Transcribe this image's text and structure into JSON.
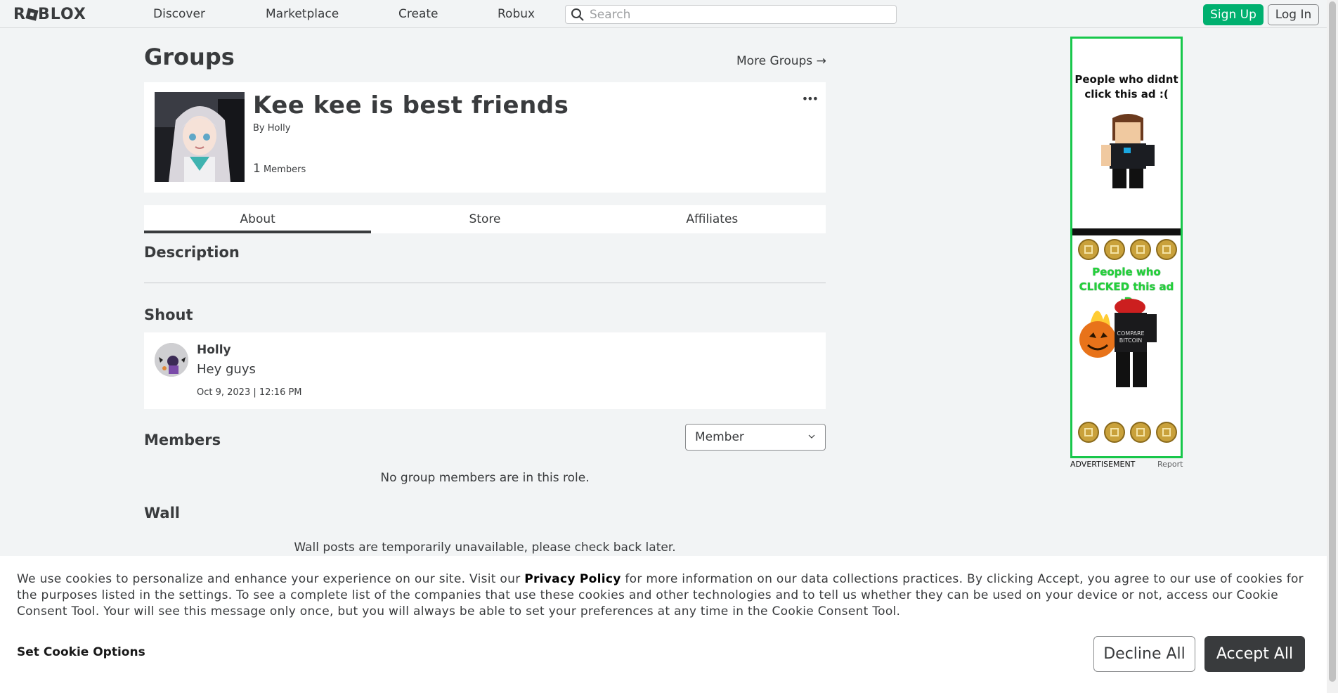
{
  "topbar": {
    "logo": "ROBLOX",
    "nav": [
      "Discover",
      "Marketplace",
      "Create",
      "Robux"
    ],
    "search_placeholder": "Search",
    "signup_label": "Sign Up",
    "login_label": "Log In"
  },
  "page": {
    "title": "Groups",
    "more_groups": "More Groups →"
  },
  "group": {
    "name": "Kee kee is best friends",
    "by_prefix": "By",
    "owner": "Holly",
    "member_count": "1",
    "members_label": "Members",
    "more_menu": "•••"
  },
  "tabs": [
    {
      "label": "About",
      "active": true
    },
    {
      "label": "Store",
      "active": false
    },
    {
      "label": "Affiliates",
      "active": false
    }
  ],
  "sections": {
    "description": "Description",
    "shout": "Shout",
    "members": "Members",
    "wall": "Wall"
  },
  "shout": {
    "user": "Holly",
    "message": "Hey guys",
    "date": "Oct 9, 2023 | 12:16 PM"
  },
  "members": {
    "role_selected": "Member",
    "empty_note": "No group members are in this role."
  },
  "wall": {
    "note": "Wall posts are temporarily unavailable, please check back later."
  },
  "ad": {
    "line1": "People who didnt click this ad :(",
    "line2": "People who CLICKED this ad :D",
    "label": "ADVERTISEMENT",
    "report": "Report",
    "border_color": "#18c74b"
  },
  "cookie": {
    "text_before": "We use cookies to personalize and enhance your experience on our site. Visit our",
    "privacy_link": "Privacy Policy",
    "text_after": "for more information on our data collections practices. By clicking Accept, you agree to our use of cookies for the purposes listed in the settings. To see a complete list of the companies that use these cookies and other technologies and to tell us whether they can be used on your device or not, access our Cookie Consent Tool. Your will see this message only once, but you will always be able to set your preferences at any time in the Cookie Consent Tool.",
    "set_options": "Set Cookie Options",
    "decline": "Decline All",
    "accept": "Accept All"
  },
  "colors": {
    "background": "#f2f4f5",
    "signup_green": "#00b06f",
    "accept_dark": "#393b3d"
  }
}
